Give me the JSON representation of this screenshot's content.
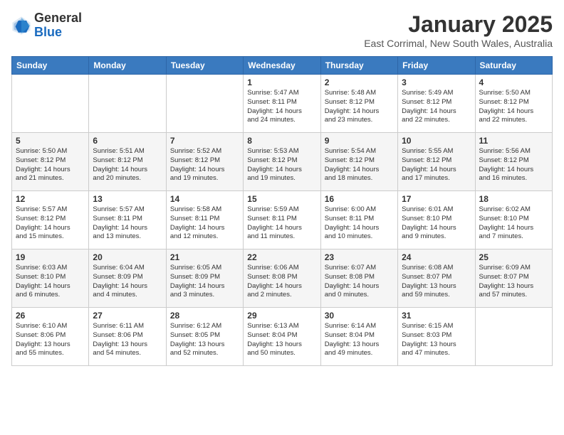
{
  "header": {
    "logo_line1": "General",
    "logo_line2": "Blue",
    "month": "January 2025",
    "location": "East Corrimal, New South Wales, Australia"
  },
  "weekdays": [
    "Sunday",
    "Monday",
    "Tuesday",
    "Wednesday",
    "Thursday",
    "Friday",
    "Saturday"
  ],
  "weeks": [
    [
      {
        "day": "",
        "detail": ""
      },
      {
        "day": "",
        "detail": ""
      },
      {
        "day": "",
        "detail": ""
      },
      {
        "day": "1",
        "detail": "Sunrise: 5:47 AM\nSunset: 8:11 PM\nDaylight: 14 hours\nand 24 minutes."
      },
      {
        "day": "2",
        "detail": "Sunrise: 5:48 AM\nSunset: 8:12 PM\nDaylight: 14 hours\nand 23 minutes."
      },
      {
        "day": "3",
        "detail": "Sunrise: 5:49 AM\nSunset: 8:12 PM\nDaylight: 14 hours\nand 22 minutes."
      },
      {
        "day": "4",
        "detail": "Sunrise: 5:50 AM\nSunset: 8:12 PM\nDaylight: 14 hours\nand 22 minutes."
      }
    ],
    [
      {
        "day": "5",
        "detail": "Sunrise: 5:50 AM\nSunset: 8:12 PM\nDaylight: 14 hours\nand 21 minutes."
      },
      {
        "day": "6",
        "detail": "Sunrise: 5:51 AM\nSunset: 8:12 PM\nDaylight: 14 hours\nand 20 minutes."
      },
      {
        "day": "7",
        "detail": "Sunrise: 5:52 AM\nSunset: 8:12 PM\nDaylight: 14 hours\nand 19 minutes."
      },
      {
        "day": "8",
        "detail": "Sunrise: 5:53 AM\nSunset: 8:12 PM\nDaylight: 14 hours\nand 19 minutes."
      },
      {
        "day": "9",
        "detail": "Sunrise: 5:54 AM\nSunset: 8:12 PM\nDaylight: 14 hours\nand 18 minutes."
      },
      {
        "day": "10",
        "detail": "Sunrise: 5:55 AM\nSunset: 8:12 PM\nDaylight: 14 hours\nand 17 minutes."
      },
      {
        "day": "11",
        "detail": "Sunrise: 5:56 AM\nSunset: 8:12 PM\nDaylight: 14 hours\nand 16 minutes."
      }
    ],
    [
      {
        "day": "12",
        "detail": "Sunrise: 5:57 AM\nSunset: 8:12 PM\nDaylight: 14 hours\nand 15 minutes."
      },
      {
        "day": "13",
        "detail": "Sunrise: 5:57 AM\nSunset: 8:11 PM\nDaylight: 14 hours\nand 13 minutes."
      },
      {
        "day": "14",
        "detail": "Sunrise: 5:58 AM\nSunset: 8:11 PM\nDaylight: 14 hours\nand 12 minutes."
      },
      {
        "day": "15",
        "detail": "Sunrise: 5:59 AM\nSunset: 8:11 PM\nDaylight: 14 hours\nand 11 minutes."
      },
      {
        "day": "16",
        "detail": "Sunrise: 6:00 AM\nSunset: 8:11 PM\nDaylight: 14 hours\nand 10 minutes."
      },
      {
        "day": "17",
        "detail": "Sunrise: 6:01 AM\nSunset: 8:10 PM\nDaylight: 14 hours\nand 9 minutes."
      },
      {
        "day": "18",
        "detail": "Sunrise: 6:02 AM\nSunset: 8:10 PM\nDaylight: 14 hours\nand 7 minutes."
      }
    ],
    [
      {
        "day": "19",
        "detail": "Sunrise: 6:03 AM\nSunset: 8:10 PM\nDaylight: 14 hours\nand 6 minutes."
      },
      {
        "day": "20",
        "detail": "Sunrise: 6:04 AM\nSunset: 8:09 PM\nDaylight: 14 hours\nand 4 minutes."
      },
      {
        "day": "21",
        "detail": "Sunrise: 6:05 AM\nSunset: 8:09 PM\nDaylight: 14 hours\nand 3 minutes."
      },
      {
        "day": "22",
        "detail": "Sunrise: 6:06 AM\nSunset: 8:08 PM\nDaylight: 14 hours\nand 2 minutes."
      },
      {
        "day": "23",
        "detail": "Sunrise: 6:07 AM\nSunset: 8:08 PM\nDaylight: 14 hours\nand 0 minutes."
      },
      {
        "day": "24",
        "detail": "Sunrise: 6:08 AM\nSunset: 8:07 PM\nDaylight: 13 hours\nand 59 minutes."
      },
      {
        "day": "25",
        "detail": "Sunrise: 6:09 AM\nSunset: 8:07 PM\nDaylight: 13 hours\nand 57 minutes."
      }
    ],
    [
      {
        "day": "26",
        "detail": "Sunrise: 6:10 AM\nSunset: 8:06 PM\nDaylight: 13 hours\nand 55 minutes."
      },
      {
        "day": "27",
        "detail": "Sunrise: 6:11 AM\nSunset: 8:06 PM\nDaylight: 13 hours\nand 54 minutes."
      },
      {
        "day": "28",
        "detail": "Sunrise: 6:12 AM\nSunset: 8:05 PM\nDaylight: 13 hours\nand 52 minutes."
      },
      {
        "day": "29",
        "detail": "Sunrise: 6:13 AM\nSunset: 8:04 PM\nDaylight: 13 hours\nand 50 minutes."
      },
      {
        "day": "30",
        "detail": "Sunrise: 6:14 AM\nSunset: 8:04 PM\nDaylight: 13 hours\nand 49 minutes."
      },
      {
        "day": "31",
        "detail": "Sunrise: 6:15 AM\nSunset: 8:03 PM\nDaylight: 13 hours\nand 47 minutes."
      },
      {
        "day": "",
        "detail": ""
      }
    ]
  ]
}
